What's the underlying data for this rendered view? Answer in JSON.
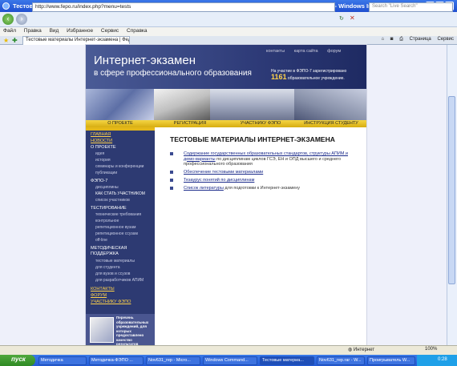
{
  "window": {
    "title": "Тестовые материалы Интернет-экзамена | Федеральный Интернет-экзамен в сфере профессионального о - Windows Internet Explorer",
    "minimize": "_",
    "maximize": "□",
    "close": "×"
  },
  "browser": {
    "address": "http://www.fepo.ru/index.php?menu=tests",
    "search_placeholder": "Search \"Live Search\"",
    "menu": [
      "Файл",
      "Правка",
      "Вид",
      "Избранное",
      "Сервис",
      "Справка"
    ],
    "tab_label": "Тестовые материалы Интернет-экзамена | Федера...",
    "toolbar": {
      "page": "Страница",
      "tools": "Сервис"
    }
  },
  "site": {
    "title_line1": "Интернет-экзамен",
    "title_line2": "в сфере профессионального образования",
    "top_links": [
      "контакты",
      "карта сайта",
      "форум"
    ],
    "reg_text": "На участие в ФЭПО-7 зарегистрировано",
    "reg_count": "1161",
    "reg_suffix": "образовательное учреждение.",
    "nav": [
      "О ПРОЕКТЕ",
      "РЕГИСТРАЦИЯ",
      "УЧАСТНИКУ ФЭПО",
      "ИНСТРУКЦИЯ СТУДЕНТУ"
    ],
    "sidebar": {
      "glavnaya": "ГЛАВНАЯ",
      "novosti": "НОВОСТИ",
      "o_proekte": "О ПРОЕКТЕ",
      "o_items": [
        "идея",
        "история",
        "семинары и конференции",
        "публикации"
      ],
      "fepo": "ФЭПО-7",
      "fepo_items": [
        "дисциплины",
        "КАК СТАТЬ УЧАСТНИКОМ",
        "список участников"
      ],
      "testing": "ТЕСТИРОВАНИЕ",
      "testing_items": [
        "технические требования",
        "контрольное",
        "репетиционное вузам",
        "репетиционное ссузам",
        "off-line"
      ],
      "method": "МЕТОДИЧЕСКАЯ ПОДДЕРЖКА",
      "method_items": [
        "тестовые материалы",
        "для студента",
        "для вузов и ссузов",
        "для разработчиков АПИМ"
      ],
      "kontakty": "КОНТАКТЫ",
      "forum": "ФОРУМ",
      "uchastniku": "УЧАСТНИКУ ФЭПО",
      "promo": "Перечень образовательных учреждений, для которых предоставлено качество результатов"
    },
    "heading": "ТЕСТОВЫЕ МАТЕРИАЛЫ ИНТЕРНЕТ-ЭКЗАМЕНА",
    "items": [
      {
        "link": "Содержание государственных образовательных стандартов, структуры АПИМ и демо-варианты",
        "rest": " по дисциплинам циклов ГСЭ, ЕН и ОПД высшего и среднего профессионального образования"
      },
      {
        "link": "Обеспечение тестовыми материалами",
        "rest": ""
      },
      {
        "link": "Тезаурус понятий по дисциплинам",
        "rest": ""
      },
      {
        "link": "Список литературы",
        "rest": " для подготовки к Интернет-экзамену"
      }
    ]
  },
  "status": {
    "zone": "Интернет",
    "zoom": "100%"
  },
  "taskbar": {
    "start": "пуск",
    "tasks": [
      "Методичка",
      "Методичка-ФЭПО ...",
      "Nov631_rep - Micro...",
      "Windows Command...",
      "Тестовые материа...",
      "Nov631_rep.rar - W...",
      "Проигрыватель W..."
    ],
    "clock": "0:28"
  },
  "colors": {
    "header": "#2e3b78",
    "nav": "#e4b81a",
    "sidebar": "#2d3a72",
    "accent": "#ffd24a"
  }
}
